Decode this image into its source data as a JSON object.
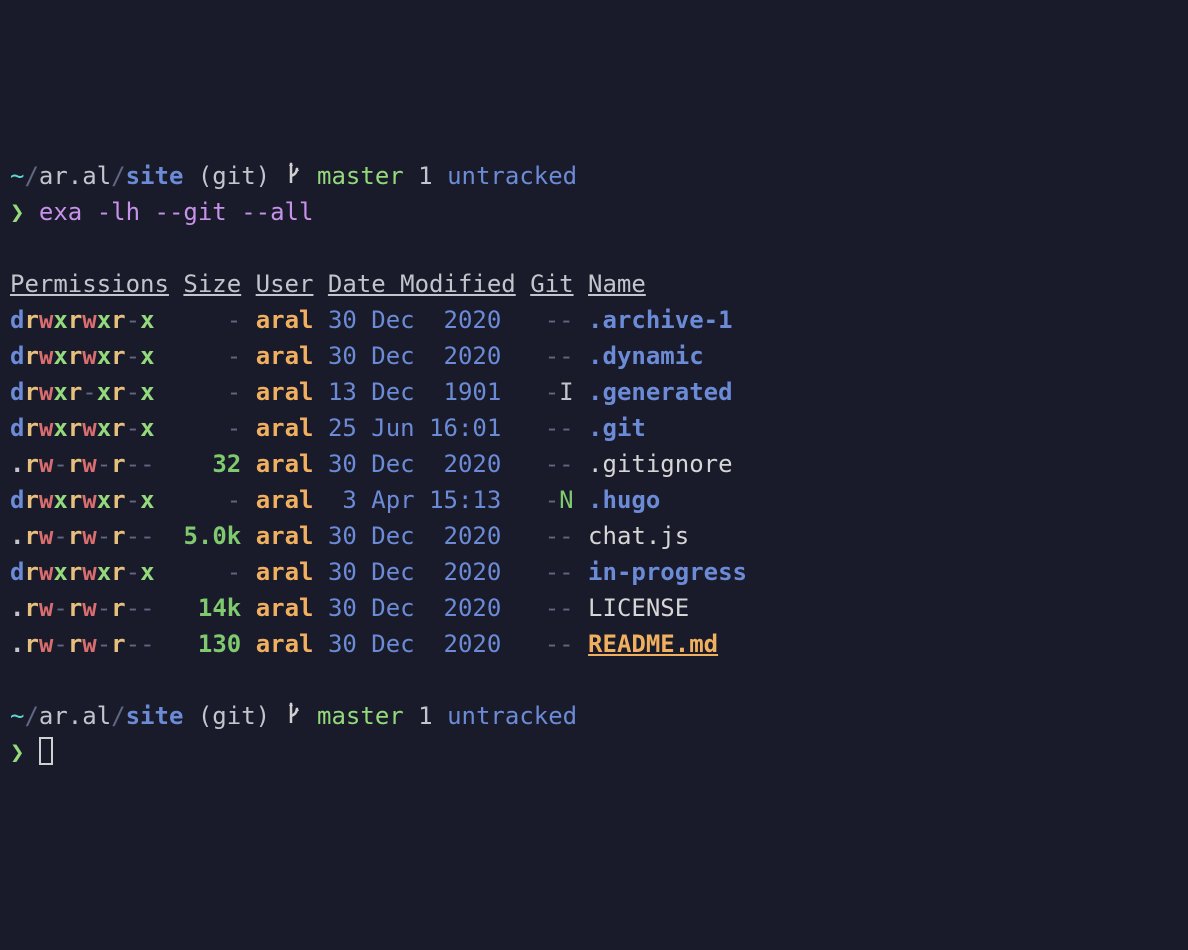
{
  "prompt1": {
    "tilde": "~",
    "slash1": "/",
    "host": "ar.al",
    "slash2": "/",
    "dir": "site",
    "git_label": "(git)",
    "branch": "master",
    "status_count": "1",
    "status_text": "untracked"
  },
  "prompt1_symbol": "❯",
  "command": "exa -lh --git --all",
  "headers": {
    "permissions": "Permissions",
    "size": "Size",
    "user": "User",
    "date": "Date Modified",
    "git": "Git",
    "name": "Name"
  },
  "rows": [
    {
      "perm": "drwxrwxr-x",
      "size": "-",
      "user": "aral",
      "date": "30 Dec  2020",
      "git": "--",
      "name": ".archive-1",
      "kind": "dir"
    },
    {
      "perm": "drwxrwxr-x",
      "size": "-",
      "user": "aral",
      "date": "30 Dec  2020",
      "git": "--",
      "name": ".dynamic",
      "kind": "dir"
    },
    {
      "perm": "drwxr-xr-x",
      "size": "-",
      "user": "aral",
      "date": "13 Dec  1901",
      "git": "-I",
      "name": ".generated",
      "kind": "dir"
    },
    {
      "perm": "drwxrwxr-x",
      "size": "-",
      "user": "aral",
      "date": "25 Jun 16:01",
      "git": "--",
      "name": ".git",
      "kind": "dir"
    },
    {
      "perm": ".rw-rw-r--",
      "size": "32",
      "user": "aral",
      "date": "30 Dec  2020",
      "git": "--",
      "name": ".gitignore",
      "kind": "file"
    },
    {
      "perm": "drwxrwxr-x",
      "size": "-",
      "user": "aral",
      "date": " 3 Apr 15:13",
      "git": "-N",
      "name": ".hugo",
      "kind": "dir"
    },
    {
      "perm": ".rw-rw-r--",
      "size": "5.0k",
      "user": "aral",
      "date": "30 Dec  2020",
      "git": "--",
      "name": "chat.js",
      "kind": "file"
    },
    {
      "perm": "drwxrwxr-x",
      "size": "-",
      "user": "aral",
      "date": "30 Dec  2020",
      "git": "--",
      "name": "in-progress",
      "kind": "dir"
    },
    {
      "perm": ".rw-rw-r--",
      "size": "14k",
      "user": "aral",
      "date": "30 Dec  2020",
      "git": "--",
      "name": "LICENSE",
      "kind": "file"
    },
    {
      "perm": ".rw-rw-r--",
      "size": "130",
      "user": "aral",
      "date": "30 Dec  2020",
      "git": "--",
      "name": "README.md",
      "kind": "doc"
    }
  ],
  "prompt2": {
    "tilde": "~",
    "slash1": "/",
    "host": "ar.al",
    "slash2": "/",
    "dir": "site",
    "git_label": "(git)",
    "branch": "master",
    "status_count": "1",
    "status_text": "untracked"
  },
  "prompt2_symbol": "❯"
}
